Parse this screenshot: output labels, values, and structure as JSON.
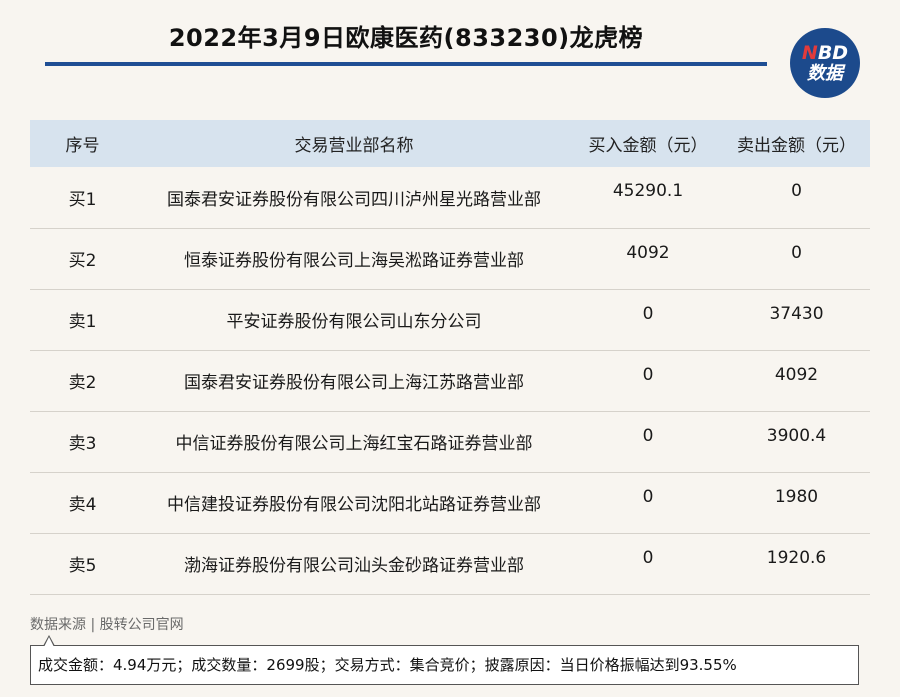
{
  "header": {
    "title": "2022年3月9日欧康医药(833230)龙虎榜",
    "logo_top_first": "N",
    "logo_top_rest": "BD",
    "logo_bottom": "数据",
    "accent": "#1f4e94"
  },
  "table": {
    "columns": [
      "序号",
      "交易营业部名称",
      "买入金额（元）",
      "卖出金额（元）"
    ],
    "rows": [
      {
        "seq": "买1",
        "name": "国泰君安证券股份有限公司四川泸州星光路营业部",
        "buy": "45290.1",
        "sell": "0"
      },
      {
        "seq": "买2",
        "name": "恒泰证券股份有限公司上海吴淞路证券营业部",
        "buy": "4092",
        "sell": "0"
      },
      {
        "seq": "卖1",
        "name": "平安证券股份有限公司山东分公司",
        "buy": "0",
        "sell": "37430"
      },
      {
        "seq": "卖2",
        "name": "国泰君安证券股份有限公司上海江苏路营业部",
        "buy": "0",
        "sell": "4092"
      },
      {
        "seq": "卖3",
        "name": "中信证券股份有限公司上海红宝石路证券营业部",
        "buy": "0",
        "sell": "3900.4"
      },
      {
        "seq": "卖4",
        "name": "中信建投证券股份有限公司沈阳北站路证券营业部",
        "buy": "0",
        "sell": "1980"
      },
      {
        "seq": "卖5",
        "name": "渤海证券股份有限公司汕头金砂路证券营业部",
        "buy": "0",
        "sell": "1920.6"
      }
    ]
  },
  "footer": {
    "source": "数据来源 | 股转公司官网",
    "summary": "成交金额：4.94万元；成交数量：2699股；交易方式：集合竞价；披露原因：当日价格振幅达到93.55%"
  }
}
